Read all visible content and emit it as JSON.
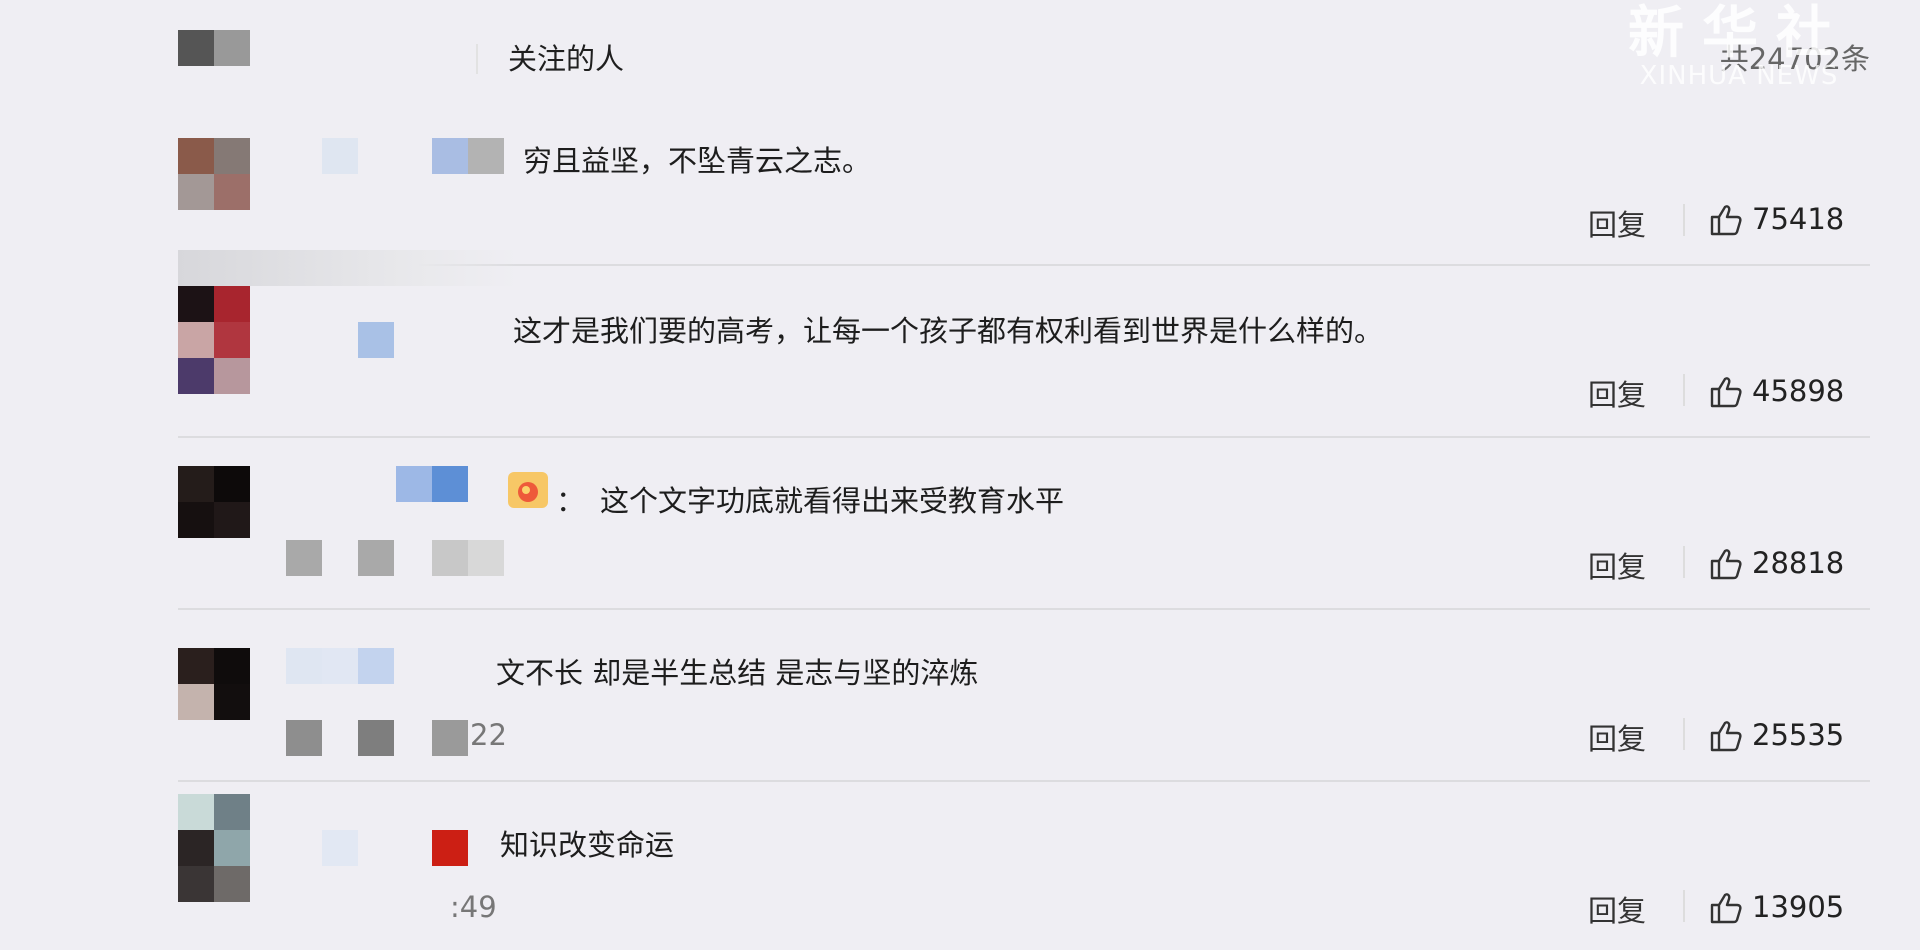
{
  "header": {
    "title": "关注的人",
    "total": "共24702条"
  },
  "watermark": {
    "cn": "新华社",
    "en": "XINHUA NEWS"
  },
  "comments": [
    {
      "text": "穷且益坚，不坠青云之志。",
      "reply": "回复",
      "likes": "75418"
    },
    {
      "text": "这才是我们要的高考，让每一个孩子都有权利看到世界是什么样的。",
      "reply": "回复",
      "likes": "45898"
    },
    {
      "text": "这个文字功底就看得出来受教育水平",
      "reply": "回复",
      "likes": "28818"
    },
    {
      "text": "文不长 却是半生总结 是志与坚的淬炼",
      "reply": "回复",
      "likes": "25535"
    },
    {
      "text": "知识改变命运",
      "reply": "回复",
      "likes": "13905"
    }
  ],
  "partial_texts": {
    "colon": "：",
    "c4_time": "22",
    "c5_time": ":49"
  },
  "colors": {
    "background": "#efeef3",
    "divider": "#dcdcdf",
    "text": "#1d1d1d"
  },
  "icons": [
    "thumbs-up-icon",
    "crown-badge-icon"
  ]
}
